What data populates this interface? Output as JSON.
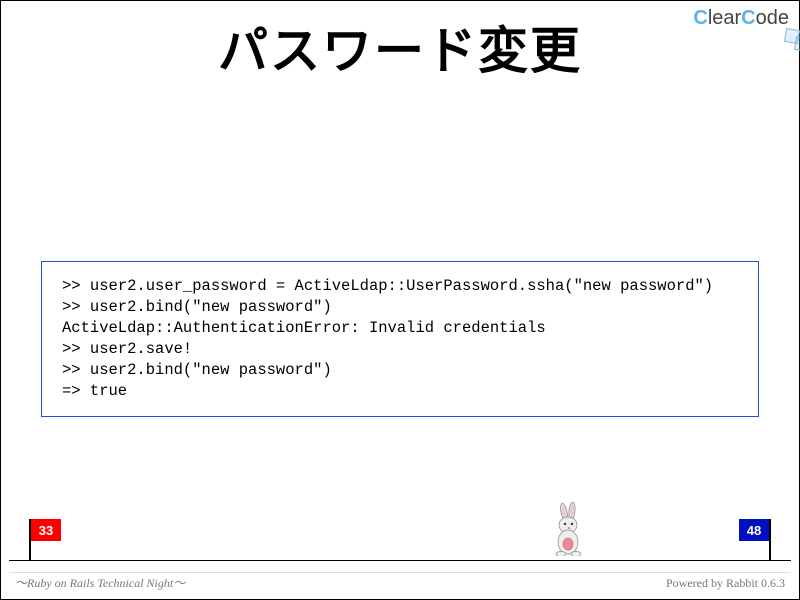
{
  "logo": {
    "text_full": "ClearCode",
    "c1": "C",
    "clear": "lear",
    "c2": "C",
    "ode": "ode"
  },
  "title": "パスワード変更",
  "code": ">> user2.user_password = ActiveLdap::UserPassword.ssha(\"new password\")\n>> user2.bind(\"new password\")\nActiveLdap::AuthenticationError: Invalid credentials\n>> user2.save!\n>> user2.bind(\"new password\")\n=> true",
  "progress": {
    "current": "33",
    "total": "48"
  },
  "footer": {
    "left": "～Ruby on Rails Technical Night～",
    "right": "Powered by Rabbit 0.6.3"
  }
}
